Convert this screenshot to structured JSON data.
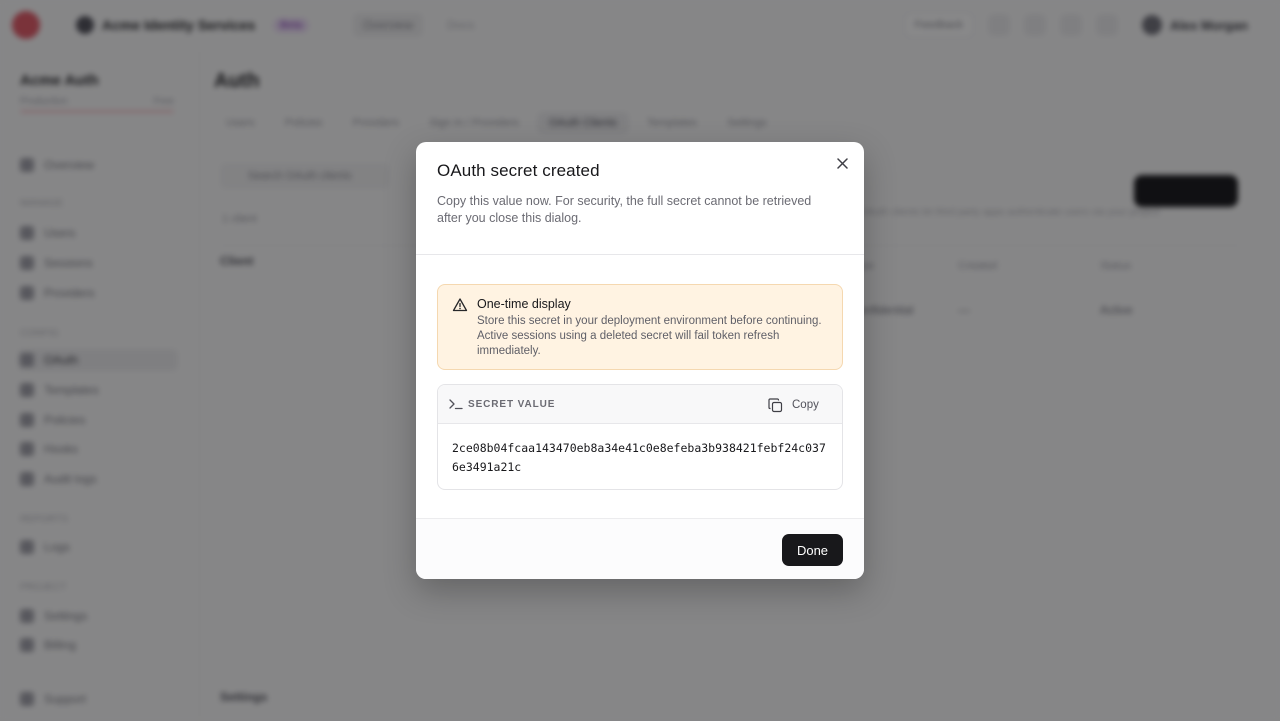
{
  "background": {
    "org_name": "Acme Identity Services",
    "org_badge": "Beta",
    "top_tab": "Overview",
    "top_tab2": "Docs",
    "top_button": "Feedback",
    "user_name": "Alex Morgan",
    "project_title": "Acme Auth",
    "project_sub_left": "Production",
    "project_sub_right": "Free",
    "page_title": "Auth",
    "tabs": [
      "Users",
      "Policies",
      "Providers",
      "Sign In / Providers",
      "OAuth Clients",
      "Templates",
      "Settings"
    ],
    "filter_text": "Search OAuth clients",
    "count_text": "1 client",
    "row_label": "Client",
    "hint": "OAuth clients let third party apps authenticate users via your project",
    "col_headers": [
      "Type",
      "Created",
      "Status"
    ],
    "cells": [
      "Confidential",
      "—",
      "Active"
    ],
    "footer_link": "Settings",
    "sidebar_items": [
      "Overview",
      "Users",
      "Sessions",
      "Providers",
      "OAuth",
      "Templates",
      "Policies",
      "Hooks",
      "Audit logs",
      "Logs",
      "Settings",
      "Billing",
      "Support"
    ],
    "sidebar_heads": [
      "MANAGE",
      "CONFIG",
      "REPORTS",
      "PROJECT"
    ]
  },
  "dialog": {
    "title": "OAuth secret created",
    "description": "Copy this value now. For security, the full secret cannot be retrieved after you close this dialog.",
    "warning_title": "One-time display",
    "warning_text": "Store this secret in your deployment environment before continuing. Active sessions using a deleted secret will fail token refresh immediately.",
    "secret_label": "SECRET VALUE",
    "copy_label": "Copy",
    "secret_value": "2ce08b04fcaa143470eb8a34e41c0e8efeba3b938421febf24c0376e3491a21c",
    "done_label": "Done"
  }
}
